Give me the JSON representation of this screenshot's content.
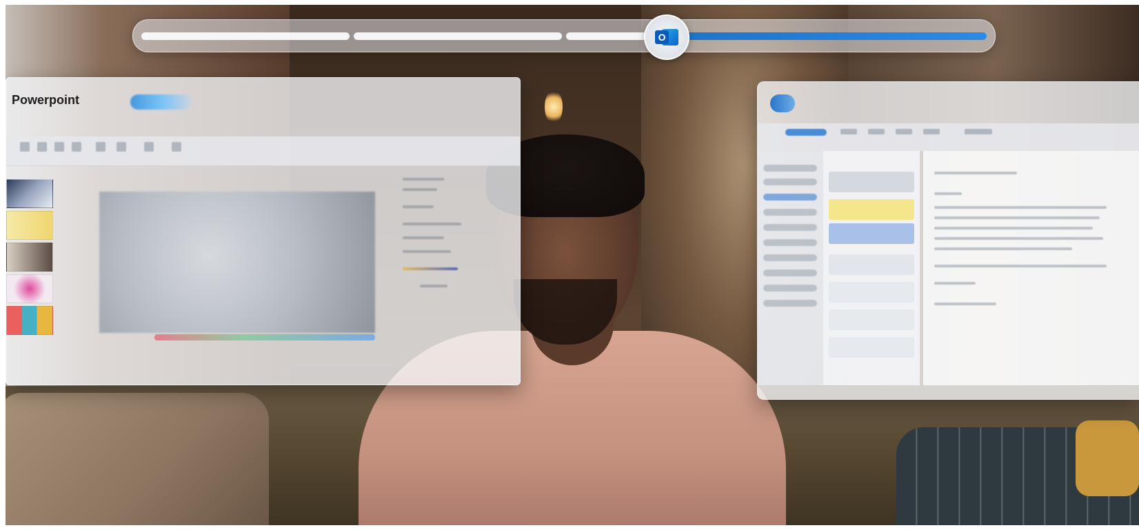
{
  "scrubber": {
    "progress": 0.62,
    "segments": 4,
    "current_app_icon": "outlook-icon",
    "current_app_letter": "O",
    "accent_color": "#1d73c9"
  },
  "powerpoint_panel": {
    "title": "Powerpoint"
  },
  "outlook_panel": {
    "icon": "outlook-logo-icon"
  },
  "colors": {
    "panel_bg": "#f5f6f8",
    "fill": "#2b8ae6"
  }
}
